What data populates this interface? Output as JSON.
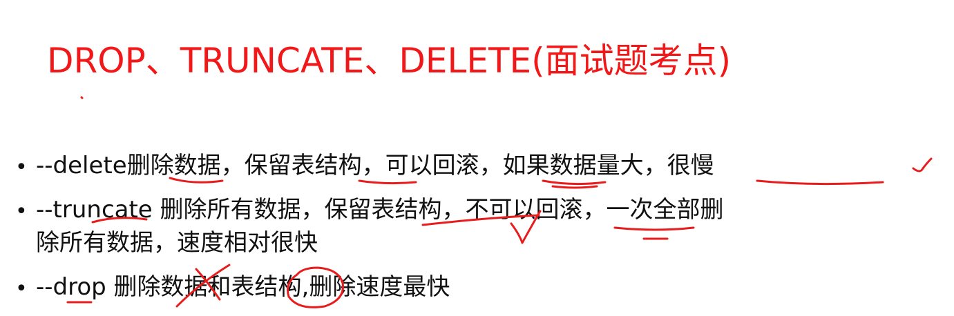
{
  "slide": {
    "title": "DROP、TRUNCATE、DELETE(面试题考点)",
    "bullets": [
      {
        "lines": [
          "--delete删除数据，保留表结构，可以回滚，如果数据量大，很慢"
        ]
      },
      {
        "lines": [
          "--truncate 删除所有数据，保留表结构，不可以回滚，一次全部删",
          "除所有数据，速度相对很快"
        ]
      },
      {
        "lines": [
          "--drop 删除数据和表结构,删除速度最快"
        ]
      }
    ]
  },
  "colors": {
    "title": "#f01818",
    "body_text": "#111111",
    "annotation_ink": "#e81c1c",
    "background": "#ffffff"
  }
}
